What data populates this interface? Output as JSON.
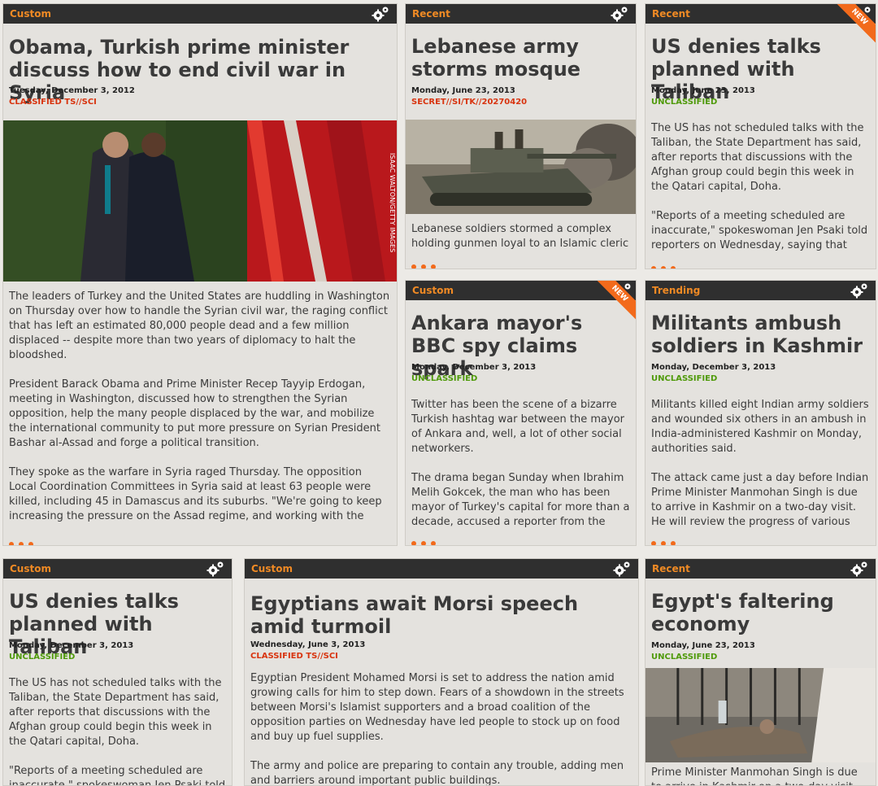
{
  "cards": [
    {
      "category": "Custom",
      "title": "Obama, Turkish prime minister discuss how to end civil war in Syria",
      "date": "Tuesday, December 3, 2012",
      "classification": "CLASSIFIED TS//SCI",
      "image_caption": "ISAAC WALTON/GETTY IMAGES",
      "paragraphs": [
        "The leaders of Turkey and the United States are huddling in Washington on Thursday over how to handle the Syrian civil war, the raging conflict that has left an estimated 80,000 people dead and a few million displaced -- despite more than two years of diplomacy to halt the bloodshed.",
        "President Barack Obama and Prime Minister Recep Tayyip Erdogan, meeting in Washington, discussed how to strengthen the Syrian opposition, help the many people displaced by the war, and mobilize the international community to put more pressure on Syrian President Bashar al-Assad and forge a political transition.",
        "They spoke as the warfare in Syria raged Thursday. The opposition Local Coordination Committees in Syria said at least 63 people were killed, including 45 in Damascus and its suburbs. \"We're going to keep increasing the pressure on the Assad regime, and working with the"
      ]
    },
    {
      "category": "Recent",
      "title": "Lebanese army storms mosque",
      "date": "Monday, June 23, 2013",
      "classification": "SECRET//SI/TK//20270420",
      "paragraphs": [
        "Lebanese soldiers stormed a complex holding gunmen loyal to an Islamic cleric"
      ]
    },
    {
      "category": "Recent",
      "ribbon": "NEW",
      "title": "US denies talks planned with Taliban",
      "date": "Monday, June 23, 2013",
      "classification": "UNCLASSIFIED",
      "paragraphs": [
        "The US has not scheduled talks with the Taliban, the State Department has said, after reports that discussions with the Afghan group could begin this week in the Qatari capital, Doha.",
        "\"Reports of a meeting scheduled are inaccurate,\" spokeswoman Jen Psaki told reporters on Wednesday, saying that"
      ]
    },
    {
      "category": "Custom",
      "ribbon": "NEW",
      "title": "Ankara mayor's BBC spy claims spark",
      "date": "Monday, December 3, 2013",
      "classification": "UNCLASSIFIED",
      "paragraphs": [
        "Twitter has been the scene of a bizarre Turkish hashtag war between the mayor of Ankara and, well, a lot of other social networkers.",
        "The drama began Sunday when Ibrahim Melih Gokcek, the man who has been mayor of Turkey's capital for more than a decade, accused a reporter from the"
      ]
    },
    {
      "category": "Trending",
      "title": "Militants ambush soldiers in Kashmir",
      "date": "Monday, December 3, 2013",
      "classification": "UNCLASSIFIED",
      "paragraphs": [
        "Militants killed eight Indian army soldiers and wounded six others in an ambush in India-administered Kashmir on Monday, authorities said.",
        "The attack came just a day before Indian Prime Minister Manmohan Singh is due to arrive in Kashmir on a two-day visit. He will review the progress of various"
      ]
    },
    {
      "category": "Custom",
      "title": "US denies talks planned with Taliban",
      "date": "Monday, December 3, 2013",
      "classification": "UNCLASSIFIED",
      "paragraphs": [
        "The US has not scheduled talks with the Taliban, the State Department has said, after reports that discussions with the Afghan group could begin this week in the Qatari capital, Doha.",
        "\"Reports of a meeting scheduled are inaccurate,\" spokeswoman Jen Psaki told reporters on Wednesday, saying that"
      ]
    },
    {
      "category": "Custom",
      "title": "Egyptians await Morsi speech amid turmoil",
      "date": "Wednesday, June 3, 2013",
      "classification": "CLASSIFIED TS//SCI",
      "paragraphs": [
        "Egyptian President Mohamed Morsi is set to address the nation amid growing calls for him to step down. Fears of a showdown in the streets between Morsi's Islamist supporters and a broad coalition of the opposition parties on Wednesday have led people to stock up on food and buy up fuel supplies.",
        "The army and police are preparing to contain any trouble, adding men and barriers around important public buildings."
      ]
    },
    {
      "category": "Recent",
      "title": "Egypt's faltering economy",
      "date": "Monday, June 23, 2013",
      "classification": "UNCLASSIFIED",
      "paragraphs": [
        "Prime Minister Manmohan Singh is due to arrive in Kashmir on a two-day visit. He"
      ]
    }
  ]
}
